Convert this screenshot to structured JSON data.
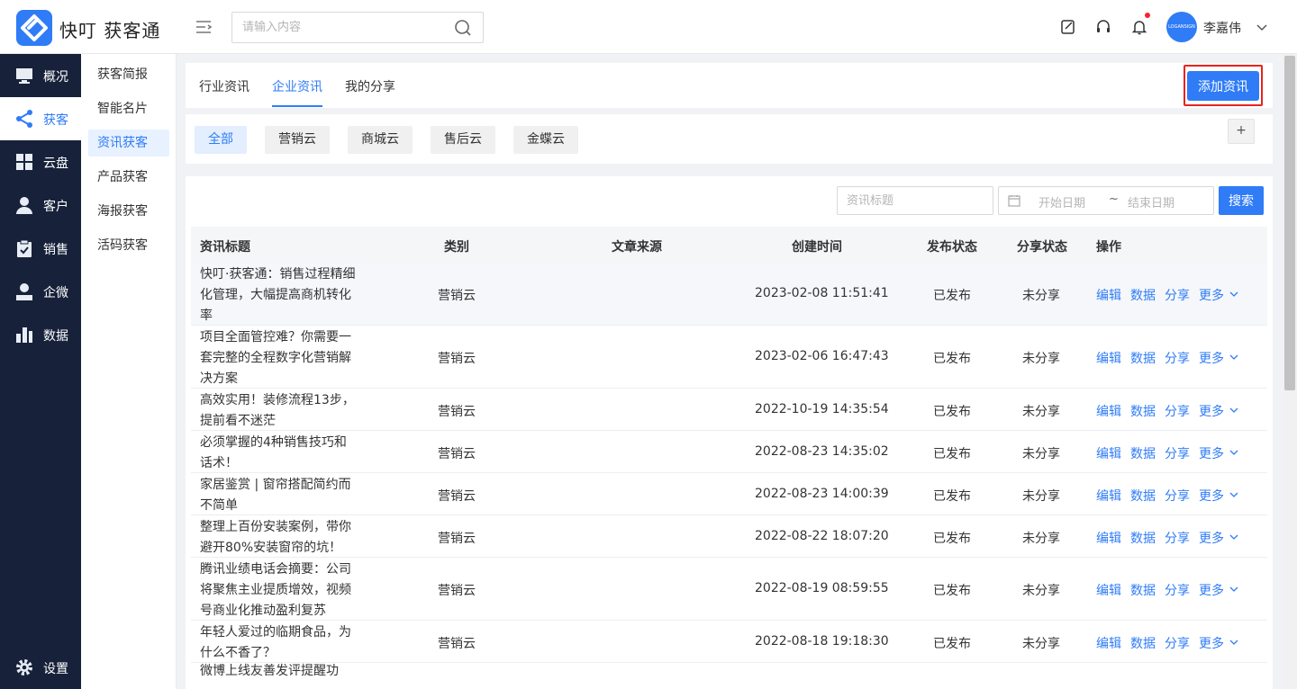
{
  "header": {
    "brand": "快叮 获客通",
    "search_placeholder": "请输入内容",
    "username": "李嘉伟",
    "avatar_text": "LOGANSIGN",
    "accent_color": "#2f7cf6"
  },
  "sidenav": {
    "items": [
      {
        "label": "概况",
        "icon": "monitor-icon"
      },
      {
        "label": "获客",
        "icon": "share-nodes-icon",
        "active": true
      },
      {
        "label": "云盘",
        "icon": "grid-icon"
      },
      {
        "label": "客户",
        "icon": "person-icon"
      },
      {
        "label": "销售",
        "icon": "clipboard-check-icon"
      },
      {
        "label": "企微",
        "icon": "user-icon"
      },
      {
        "label": "数据",
        "icon": "bar-chart-icon"
      }
    ],
    "settings": "设置"
  },
  "submenu": {
    "items": [
      "获客简报",
      "智能名片",
      "资讯获客",
      "产品获客",
      "海报获客",
      "活码获客"
    ],
    "active_index": 2
  },
  "tabs": {
    "items": [
      "行业资讯",
      "企业资讯",
      "我的分享"
    ],
    "active_index": 1,
    "add_button": "添加资讯"
  },
  "categories": {
    "items": [
      "全部",
      "营销云",
      "商城云",
      "售后云",
      "金蝶云"
    ],
    "active_index": 0,
    "plus": "+"
  },
  "filters": {
    "title_placeholder": "资讯标题",
    "start_date": "开始日期",
    "tilde": "~",
    "end_date": "结束日期",
    "search_button": "搜索"
  },
  "table": {
    "columns": [
      "资讯标题",
      "类别",
      "文章来源",
      "创建时间",
      "发布状态",
      "分享状态",
      "操作"
    ],
    "actions": [
      "编辑",
      "数据",
      "分享",
      "更多"
    ],
    "rows": [
      {
        "title": "快叮·获客通：销售过程精细化管理，大幅提高商机转化率",
        "category": "营销云",
        "source": "",
        "created": "2023-02-08 11:51:41",
        "publish": "已发布",
        "share": "未分享"
      },
      {
        "title": "项目全面管控难？你需要一套完整的全程数字化营销解决方案",
        "category": "营销云",
        "source": "",
        "created": "2023-02-06 16:47:43",
        "publish": "已发布",
        "share": "未分享"
      },
      {
        "title": "高效实用！装修流程13步，提前看不迷茫",
        "category": "营销云",
        "source": "",
        "created": "2022-10-19 14:35:54",
        "publish": "已发布",
        "share": "未分享"
      },
      {
        "title": "必须掌握的4种销售技巧和话术！",
        "category": "营销云",
        "source": "",
        "created": "2022-08-23 14:35:02",
        "publish": "已发布",
        "share": "未分享"
      },
      {
        "title": "家居鉴赏 | 窗帘搭配简约而不简单",
        "category": "营销云",
        "source": "",
        "created": "2022-08-23 14:00:39",
        "publish": "已发布",
        "share": "未分享"
      },
      {
        "title": "整理上百份安装案例，带你避开80%安装窗帘的坑！",
        "category": "营销云",
        "source": "",
        "created": "2022-08-22 18:07:20",
        "publish": "已发布",
        "share": "未分享"
      },
      {
        "title": "腾讯业绩电话会摘要：公司将聚焦主业提质增效，视频号商业化推动盈利复苏",
        "category": "营销云",
        "source": "",
        "created": "2022-08-19 08:59:55",
        "publish": "已发布",
        "share": "未分享"
      },
      {
        "title": "年轻人爱过的临期食品，为什么不香了？",
        "category": "营销云",
        "source": "",
        "created": "2022-08-18 19:18:30",
        "publish": "已发布",
        "share": "未分享"
      },
      {
        "title": "微博上线友善发评提醒功",
        "category": "",
        "source": "",
        "created": "",
        "publish": "",
        "share": ""
      }
    ]
  }
}
